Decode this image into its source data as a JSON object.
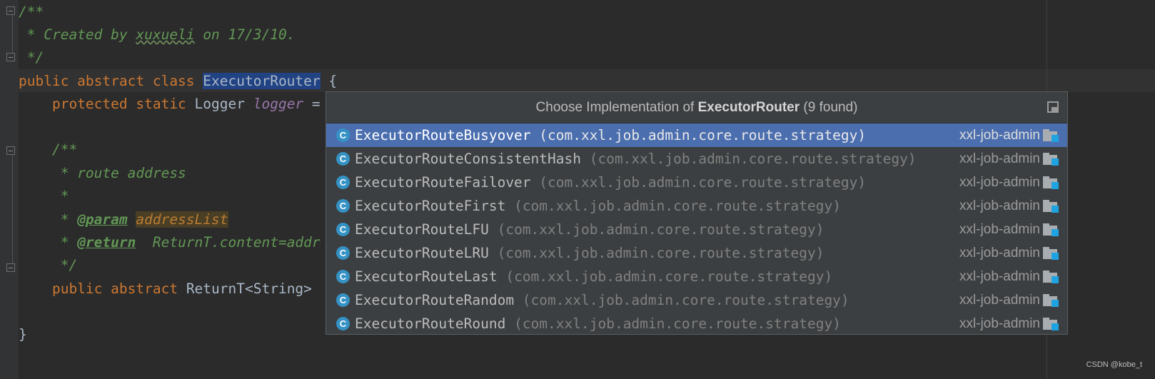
{
  "editor": {
    "lines": {
      "l1": "/**",
      "l2": " * Created by ",
      "l2_author": "xuxueli",
      "l2_rest": " on 17/3/10.",
      "l3": " */",
      "l4_kw": "public abstract class ",
      "l4_name": "ExecutorRouter",
      "l4_rest": " {",
      "l5_kw": "    protected static ",
      "l5_type": "Logger ",
      "l5_field": "logger",
      "l5_rest": " =",
      "l7": "    /**",
      "l8": "     * route address",
      "l9": "     *",
      "l10_pre": "     * ",
      "l10_tag": "@param",
      "l10_sp": " ",
      "l10_param": "addressList",
      "l11_pre": "     * ",
      "l11_tag": "@return",
      "l11_rest": "  ReturnT.content=addr",
      "l12": "     */",
      "l13_kw": "    public abstract ",
      "l13_rest": "ReturnT<String>",
      "l15": "}"
    }
  },
  "popup": {
    "title_prefix": "Choose Implementation of ",
    "title_class": "ExecutorRouter",
    "title_suffix": " (9 found)",
    "pin_icon": "pin-icon",
    "items": [
      {
        "icon": "C",
        "name": "ExecutorRouteBusyover",
        "package": " (com.xxl.job.admin.core.route.strategy)",
        "module": "xxl-job-admin"
      },
      {
        "icon": "C",
        "name": "ExecutorRouteConsistentHash",
        "package": " (com.xxl.job.admin.core.route.strategy)",
        "module": "xxl-job-admin"
      },
      {
        "icon": "C",
        "name": "ExecutorRouteFailover",
        "package": " (com.xxl.job.admin.core.route.strategy)",
        "module": "xxl-job-admin"
      },
      {
        "icon": "C",
        "name": "ExecutorRouteFirst",
        "package": " (com.xxl.job.admin.core.route.strategy)",
        "module": "xxl-job-admin"
      },
      {
        "icon": "C",
        "name": "ExecutorRouteLFU",
        "package": " (com.xxl.job.admin.core.route.strategy)",
        "module": "xxl-job-admin"
      },
      {
        "icon": "C",
        "name": "ExecutorRouteLRU",
        "package": " (com.xxl.job.admin.core.route.strategy)",
        "module": "xxl-job-admin"
      },
      {
        "icon": "C",
        "name": "ExecutorRouteLast",
        "package": " (com.xxl.job.admin.core.route.strategy)",
        "module": "xxl-job-admin"
      },
      {
        "icon": "C",
        "name": "ExecutorRouteRandom",
        "package": " (com.xxl.job.admin.core.route.strategy)",
        "module": "xxl-job-admin"
      },
      {
        "icon": "C",
        "name": "ExecutorRouteRound",
        "package": " (com.xxl.job.admin.core.route.strategy)",
        "module": "xxl-job-admin"
      }
    ]
  },
  "colors": {
    "background": "#2b2b2b",
    "keyword": "#cc7832",
    "comment": "#629755",
    "selection": "#214283",
    "popup_selected": "#4b6eaf",
    "class_icon": "#3592c4"
  },
  "watermark": "CSDN @kobe_t"
}
